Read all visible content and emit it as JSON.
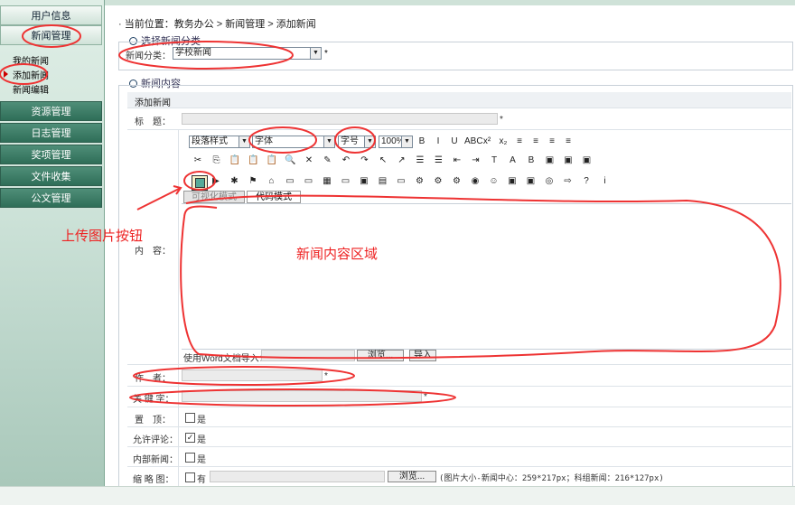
{
  "sidebar": {
    "items": [
      {
        "label": "用户信息"
      },
      {
        "label": "新闻管理"
      },
      {
        "label": "资源管理"
      },
      {
        "label": "日志管理"
      },
      {
        "label": "奖项管理"
      },
      {
        "label": "文件收集"
      },
      {
        "label": "公文管理"
      }
    ],
    "sub_items": [
      {
        "label": "我的新闻"
      },
      {
        "label": "添加新闻"
      },
      {
        "label": "新闻编辑"
      }
    ]
  },
  "breadcrumb": {
    "text": "· 当前位置：教务办公 > 新闻管理 > 添加新闻"
  },
  "category_section": {
    "title": "选择新闻分类",
    "label": "新闻分类：",
    "value": "学校新闻",
    "required": "*"
  },
  "content_section": {
    "title": "新闻内容",
    "subheader": "添加新闻",
    "title_label": "标　题：",
    "content_label": "内　容：",
    "author_label": "作　者：",
    "keyword_label": "关 键 字：",
    "pin_label": "置　顶：",
    "pin_option": "是",
    "comment_label": "允许评论：",
    "comment_option": "是",
    "internal_label": "内部新闻：",
    "internal_option": "是",
    "thumb_label": "缩 略 图：",
    "thumb_option": "有",
    "thumb_browse": "浏览...",
    "thumb_hint": "(图片大小-新闻中心：259*217px；科组新闻：216*127px)",
    "required": "*"
  },
  "editor": {
    "paragraph_style": "段落样式",
    "font": "字体",
    "font_size": "字号",
    "zoom": "100%",
    "tab_visual": "可视化模式",
    "tab_code": "代码模式",
    "word_import_label": "使用Word文档导入：",
    "browse": "浏览...",
    "import": "导入",
    "toolbar_row1": [
      "B",
      "I",
      "U",
      "ABC",
      "x²",
      "x₂",
      "≡",
      "≡",
      "≡",
      "≡"
    ],
    "toolbar_row2": [
      "✂",
      "⎘",
      "📋",
      "📋",
      "📋",
      "🔍",
      "✕",
      "✎",
      "↶",
      "↷",
      "↖",
      "↗",
      "☰",
      "☰",
      "⇤",
      "⇥",
      "T",
      "A",
      "B",
      "▣",
      "▣",
      "▣"
    ],
    "toolbar_row3": [
      "▶",
      "✱",
      "⚑",
      "⌂",
      "▭",
      "▭",
      "▦",
      "▭",
      "▣",
      "▤",
      "▭",
      "⚙",
      "⚙",
      "⚙",
      "◉",
      "☺",
      "▣",
      "▣",
      "◎",
      "⇨",
      "?",
      "i"
    ]
  },
  "annotations": {
    "upload_button": "上传图片按钮",
    "content_area": "新闻内容区域"
  }
}
